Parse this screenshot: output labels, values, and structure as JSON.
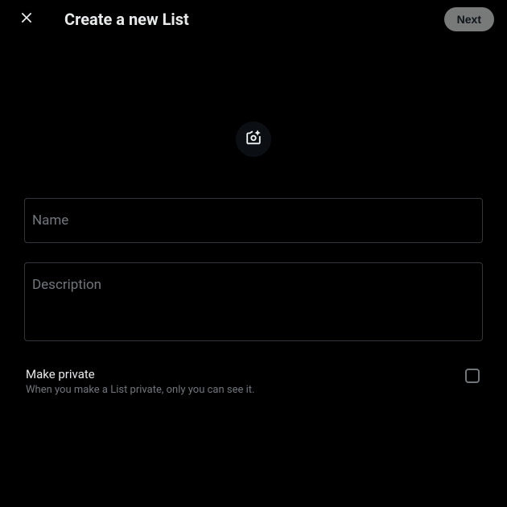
{
  "header": {
    "title": "Create a new List",
    "nextLabel": "Next"
  },
  "fields": {
    "name": {
      "label": "Name",
      "value": ""
    },
    "description": {
      "label": "Description",
      "value": ""
    }
  },
  "private": {
    "label": "Make private",
    "description": "When you make a List private, only you can see it.",
    "checked": false
  }
}
